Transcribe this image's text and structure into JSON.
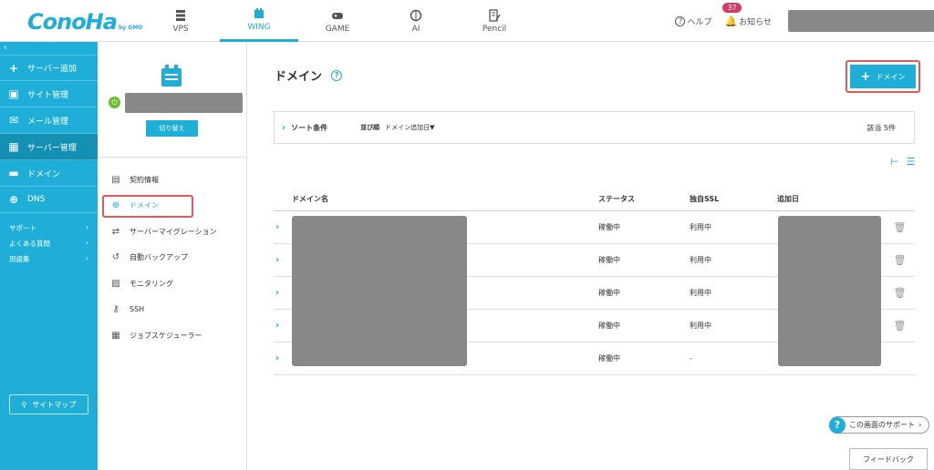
{
  "logo": {
    "main": "ConoHa",
    "sub": "by GMO"
  },
  "topnav": [
    {
      "label": "VPS",
      "icon": "server-icon",
      "active": false
    },
    {
      "label": "WING",
      "icon": "wing-server-icon",
      "active": true
    },
    {
      "label": "GAME",
      "icon": "gamepad-icon",
      "active": false
    },
    {
      "label": "AI",
      "icon": "brain-icon",
      "active": false
    },
    {
      "label": "Pencil",
      "icon": "pencil-doc-icon",
      "active": false
    }
  ],
  "header": {
    "help": "ヘルプ",
    "notice": "お知らせ",
    "notice_count": "37"
  },
  "leftnav": {
    "items": [
      {
        "label": "サーバー追加",
        "icon": "plus-icon"
      },
      {
        "label": "サイト管理",
        "icon": "site-icon"
      },
      {
        "label": "メール管理",
        "icon": "mail-icon"
      },
      {
        "label": "サーバー管理",
        "icon": "server-manage-icon"
      },
      {
        "label": "ドメイン",
        "icon": "domain-icon"
      },
      {
        "label": "DNS",
        "icon": "globe-icon"
      }
    ],
    "subs": [
      "サポート",
      "よくある質問",
      "用語集"
    ],
    "sitemap": "サイトマップ"
  },
  "server": {
    "switch_label": "切り替え"
  },
  "secondnav": [
    {
      "label": "契約情報",
      "icon": "contract-icon"
    },
    {
      "label": "ドメイン",
      "icon": "globe-icon"
    },
    {
      "label": "サーバーマイグレーション",
      "icon": "migration-icon"
    },
    {
      "label": "自動バックアップ",
      "icon": "backup-icon"
    },
    {
      "label": "モニタリング",
      "icon": "monitor-icon"
    },
    {
      "label": "SSH",
      "icon": "key-icon"
    },
    {
      "label": "ジョブスケジューラー",
      "icon": "scheduler-icon"
    }
  ],
  "main": {
    "title": "ドメイン",
    "add_button": "ドメイン",
    "sort": {
      "label": "ソート条件",
      "order_label": "並び順",
      "order_value": "ドメイン追加日▼",
      "count": "該当 5件"
    },
    "columns": [
      "ドメイン名",
      "ステータス",
      "独自SSL",
      "追加日"
    ],
    "rows": [
      {
        "status": "稼働中",
        "ssl": "利用中"
      },
      {
        "status": "稼働中",
        "ssl": "利用中"
      },
      {
        "status": "稼働中",
        "ssl": "利用中"
      },
      {
        "status": "稼働中",
        "ssl": "利用中"
      },
      {
        "status": "稼働中",
        "ssl": "-"
      }
    ]
  },
  "support": "この画面のサポート",
  "feedback": "フィードバック"
}
